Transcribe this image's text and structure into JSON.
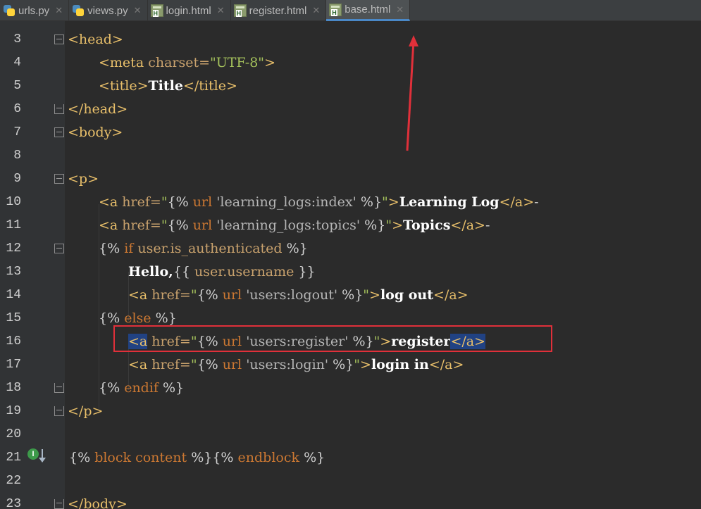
{
  "tabs": [
    {
      "label": "urls.py",
      "icon": "python-file-icon",
      "active": false
    },
    {
      "label": "views.py",
      "icon": "python-file-icon",
      "active": false
    },
    {
      "label": "login.html",
      "icon": "html-file-icon",
      "active": false
    },
    {
      "label": "register.html",
      "icon": "html-file-icon",
      "active": false
    },
    {
      "label": "base.html",
      "icon": "html-file-icon",
      "active": true
    }
  ],
  "close_glyph": "✕",
  "line_numbers": [
    "3",
    "4",
    "5",
    "6",
    "7",
    "8",
    "9",
    "10",
    "11",
    "12",
    "13",
    "14",
    "15",
    "16",
    "17",
    "18",
    "19",
    "20",
    "21",
    "22",
    "23"
  ],
  "code": {
    "l3": {
      "tag": "<head>"
    },
    "l4": {
      "open": "<meta",
      "attr": " charset=",
      "val": "\"UTF-8\"",
      "close": ">"
    },
    "l5": {
      "open": "<title>",
      "text": "Title",
      "close": "</title>"
    },
    "l6": {
      "tag": "</head>"
    },
    "l7": {
      "tag": "<body>"
    },
    "l9": {
      "tag": "<p>"
    },
    "l10": {
      "open": "<a",
      "attr": " href=",
      "q1": "\"",
      "tpl_open": "{%",
      "kw": " url ",
      "str": "'learning_logs:index'",
      "tpl_close": " %}",
      "q2": "\"",
      "gt": ">",
      "text": "Learning Log",
      "close": "</a>",
      "dash": "-"
    },
    "l11": {
      "open": "<a",
      "attr": " href=",
      "q1": "\"",
      "tpl_open": "{%",
      "kw": " url ",
      "str": "'learning_logs:topics'",
      "tpl_close": " %}",
      "q2": "\"",
      "gt": ">",
      "text": "Topics",
      "close": "</a>",
      "dash": "-"
    },
    "l12": {
      "tpl_open": "{%",
      "kw": " if ",
      "var": "user.is_authenticated",
      "tpl_close": " %}"
    },
    "l13": {
      "text": "Hello,",
      "tpl_open": "{{",
      "var": " user.username ",
      "tpl_close": "}}"
    },
    "l14": {
      "open": "<a",
      "attr": " href=",
      "q1": "\"",
      "tpl_open": "{%",
      "kw": " url ",
      "str": "'users:logout'",
      "tpl_close": " %}",
      "q2": "\"",
      "gt": ">",
      "text": "log out",
      "close": "</a>"
    },
    "l15": {
      "tpl_open": "{%",
      "kw": " else ",
      "tpl_close": "%}"
    },
    "l16": {
      "open": "<a",
      "attr": " href=",
      "q1": "\"",
      "tpl_open": "{%",
      "kw": " url ",
      "str": "'users:register'",
      "tpl_close": " %}",
      "q2": "\"",
      "gt": ">",
      "text": "register",
      "close": "</a>"
    },
    "l17": {
      "open": "<a",
      "attr": " href=",
      "q1": "\"",
      "tpl_open": "{%",
      "kw": " url ",
      "str": "'users:login'",
      "tpl_close": " %}",
      "q2": "\"",
      "gt": ">",
      "text": "login in",
      "close": "</a>"
    },
    "l18": {
      "tpl_open": "{%",
      "kw": " endif ",
      "tpl_close": "%}"
    },
    "l19": {
      "tag": "</p>"
    },
    "l21": {
      "tpl_open": "{%",
      "kw": " block content ",
      "tpl_close": "%}",
      "tpl_open2": "{%",
      "kw2": " endblock ",
      "tpl_close2": "%}"
    },
    "l23": {
      "tag": "</body>"
    }
  },
  "gutter_badge": "I",
  "colors": {
    "annotation": "#e0303a",
    "tab_active_accent": "#4a88c7"
  }
}
